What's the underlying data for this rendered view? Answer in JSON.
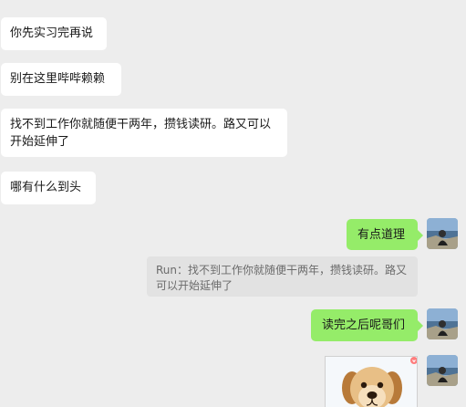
{
  "conversation": {
    "incoming": [
      {
        "text": "你先实习完再说"
      },
      {
        "text": "别在这里哔哔赖赖"
      },
      {
        "text": "找不到工作你就随便干两年，攒钱读研。路又可以开始延伸了"
      },
      {
        "text": "哪有什么到头"
      }
    ],
    "outgoing": [
      {
        "text": "有点道理"
      },
      {
        "text": "读完之后呢哥们"
      }
    ],
    "quote": {
      "text": "Run：找不到工作你就随便干两年，攒钱读研。路又可以开始延伸了"
    }
  },
  "colors": {
    "background": "#ededed",
    "incoming_bubble": "#ffffff",
    "outgoing_bubble": "#95ec69",
    "quote_bg": "#e2e2e2",
    "quote_text": "#6b6b6b"
  },
  "icons": {
    "avatar": "avatar-image",
    "sticker": "puppy-sticker-image"
  }
}
